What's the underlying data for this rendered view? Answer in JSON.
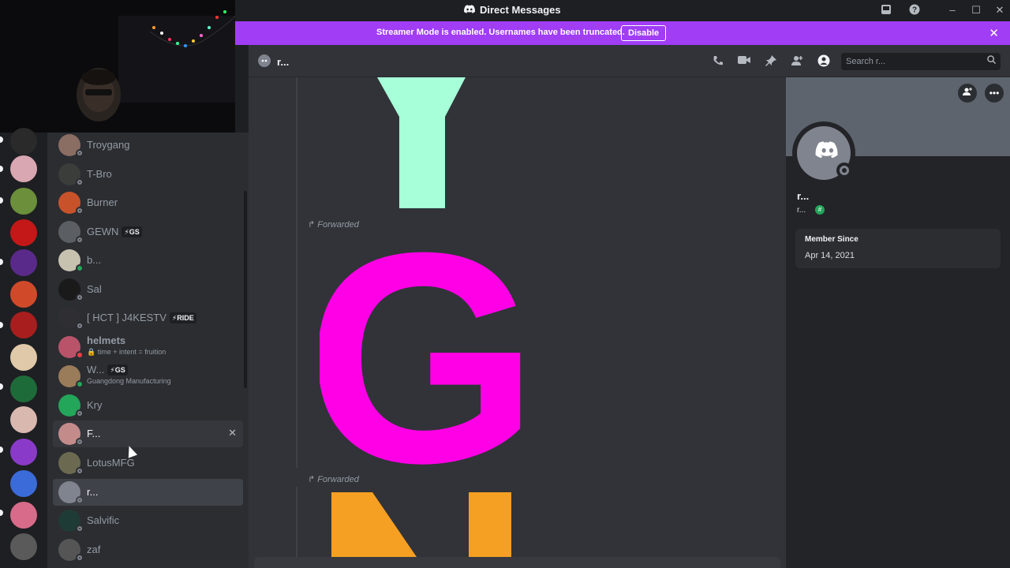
{
  "window": {
    "title": "Direct Messages",
    "controls": {
      "inbox": "inbox-icon",
      "help": "?",
      "minimize": "–",
      "maximize": "☐",
      "close": "✕"
    }
  },
  "banner": {
    "message": "Streamer Mode is enabled. Usernames have been truncated.",
    "button_label": "Disable",
    "close": "✕"
  },
  "header": {
    "channel_name": "r...",
    "search_placeholder": "Search r...",
    "icons": [
      "voice-call-icon",
      "video-call-icon",
      "pin-icon",
      "add-friends-icon",
      "profile-icon",
      "search-icon"
    ]
  },
  "dm_list": [
    {
      "name": "Troygang",
      "tag": "",
      "sub": "",
      "color": "#8a6d63"
    },
    {
      "name": "T-Bro",
      "tag": "",
      "sub": "",
      "color": "#3b3d3a"
    },
    {
      "name": "Burner",
      "tag": "",
      "sub": "",
      "color": "#c8522a"
    },
    {
      "name": "GEWN",
      "tag": "⚡GS",
      "sub": "",
      "color": "#5b5e63"
    },
    {
      "name": "b...",
      "tag": "",
      "sub": "",
      "color": "#c7c1b0"
    },
    {
      "name": "Sal",
      "tag": "",
      "sub": "",
      "color": "#1a1a1a"
    },
    {
      "name": "[ HCT ] J4KESTV",
      "tag": "⚡RIDE",
      "sub": "",
      "color": "#2e2e33"
    },
    {
      "name": "helmets",
      "tag": "",
      "sub": "🔒 time + intent = fruition",
      "color": "#b8536a"
    },
    {
      "name": "W...",
      "tag": "⚡GS",
      "sub": "Guangdong Manufacturing",
      "color": "#9a7b5a"
    },
    {
      "name": "Kry",
      "tag": "",
      "sub": "",
      "color": "#23a55a"
    },
    {
      "name": "F...",
      "tag": "",
      "sub": "",
      "color": "#c48b8b"
    },
    {
      "name": "LotusMFG",
      "tag": "",
      "sub": "",
      "color": "#6b6a50"
    },
    {
      "name": "r...",
      "tag": "",
      "sub": "",
      "color": "#80848e"
    },
    {
      "name": "Salvific",
      "tag": "",
      "sub": "",
      "color": "#1f3b35"
    },
    {
      "name": "zaf",
      "tag": "",
      "sub": "",
      "color": "#555"
    }
  ],
  "dm_close": "✕",
  "guilds": [
    "#2a2a2a",
    "#d8a7b1",
    "#6b8f3a",
    "#c41818",
    "#5a2a8a",
    "#d04a2a",
    "#a81e1e",
    "#e0c9a8",
    "#1e6b3a",
    "#d9b8b0",
    "#8a3ac8",
    "#3a6bd8",
    "#d86b8a",
    "#5a5a5a"
  ],
  "messages": [
    {
      "label": "Forwarded",
      "glyph": "G",
      "color": "#ff00e6"
    },
    {
      "label": "Forwarded",
      "glyph": "N",
      "color": "#f59f23"
    }
  ],
  "top_image": {
    "glyph": "Y",
    "color": "#a6ffd8"
  },
  "profile": {
    "display_name": "r...",
    "username": "r...",
    "member_since_label": "Member Since",
    "member_since_value": "Apr 14, 2021",
    "banner_color": "#5e646d"
  }
}
